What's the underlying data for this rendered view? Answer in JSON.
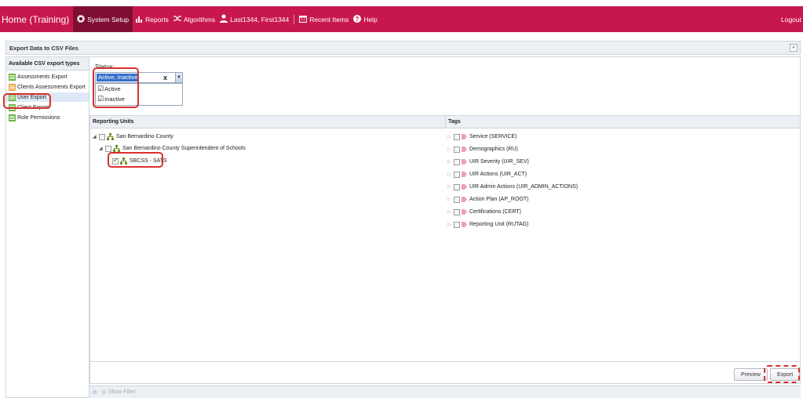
{
  "nav": {
    "home": "Home (Training)",
    "system_setup": "System Setup",
    "reports": "Reports",
    "algorithms": "Algorithms",
    "user": "Last1344, First1344",
    "recent_items": "Recent Items",
    "help": "Help",
    "logout": "Logout"
  },
  "page": {
    "title": "Export Data to CSV Files"
  },
  "left_panel": {
    "title": "Available CSV export types",
    "items": [
      {
        "label": "Assessments Export"
      },
      {
        "label": "Clients Assessments Export"
      },
      {
        "label": "User Export"
      },
      {
        "label": "Client Export"
      },
      {
        "label": "Role Permissions"
      }
    ]
  },
  "status": {
    "label": "Status:",
    "selected_value": "Active, Inactive",
    "clear": "x",
    "options": [
      {
        "label": "Active"
      },
      {
        "label": "Inactive"
      }
    ]
  },
  "reporting_units": {
    "header": "Reporting Units",
    "tree": [
      {
        "label": "San Bernardino County"
      },
      {
        "label": "San Bernardino County Superintendent of Schools"
      },
      {
        "label": "SBCSS - SATS"
      }
    ]
  },
  "tags": {
    "header": "Tags",
    "items": [
      {
        "label": "Service (SERVICE)"
      },
      {
        "label": "Demographics (RU)"
      },
      {
        "label": "UIR Severity (UIR_SEV)"
      },
      {
        "label": "UIR Actions (UIR_ACT)"
      },
      {
        "label": "UIR Admin Actions (UIR_ADMIN_ACTIONS)"
      },
      {
        "label": "Action Plan (AP_ROOT)"
      },
      {
        "label": "Certifications (CERT)"
      },
      {
        "label": "Reporting Unit (RUTAG)"
      }
    ]
  },
  "buttons": {
    "preview": "Preview",
    "export": "Export"
  },
  "footer": {
    "show_filter": "Show Filter"
  },
  "colors": {
    "brand": "#c8174f",
    "highlight": "#d9302f",
    "selection": "#3470cc"
  }
}
